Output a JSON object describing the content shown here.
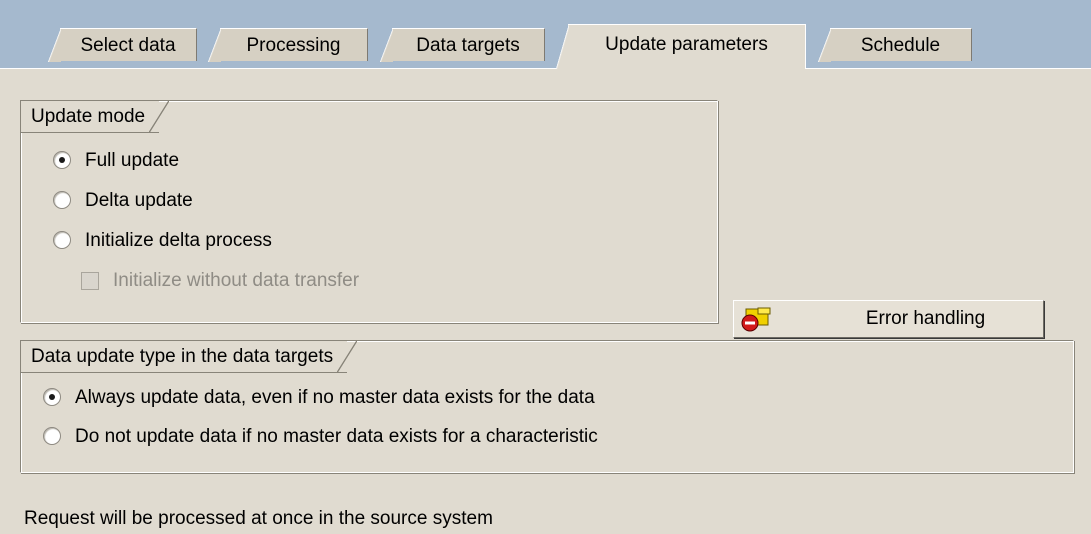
{
  "tabs": [
    {
      "label": "Select data",
      "active": false
    },
    {
      "label": "Processing",
      "active": false
    },
    {
      "label": "Data targets",
      "active": false
    },
    {
      "label": "Update parameters",
      "active": true
    },
    {
      "label": "Schedule",
      "active": false
    }
  ],
  "update_mode": {
    "title": "Update mode",
    "options": [
      {
        "label": "Full update",
        "selected": true
      },
      {
        "label": "Delta update",
        "selected": false
      },
      {
        "label": "Initialize delta process",
        "selected": false
      }
    ],
    "checkbox": {
      "label": "Initialize without data transfer",
      "checked": false,
      "enabled": false
    }
  },
  "error_handling": {
    "label": "Error handling",
    "icon": "error-handling-icon"
  },
  "data_update_type": {
    "title": "Data update type in the data targets",
    "options": [
      {
        "label": "Always update data, even if no master data exists for the data",
        "selected": true
      },
      {
        "label": "Do not update data if no master data exists for a characteristic",
        "selected": false
      }
    ]
  },
  "status_text": "Request will be processed at once in the source system",
  "colors": {
    "tabstrip_bg": "#a5b9ce",
    "panel_bg": "#e0dbd0",
    "tab_bg": "#d6d0c3"
  }
}
